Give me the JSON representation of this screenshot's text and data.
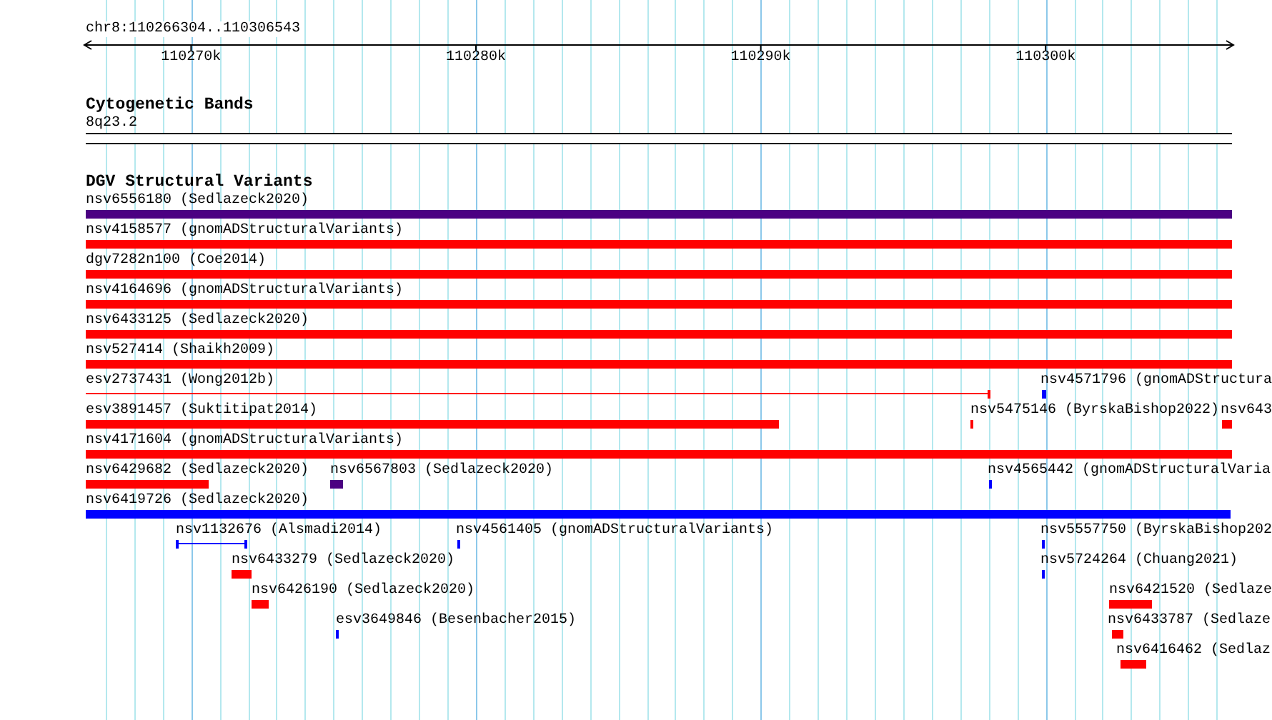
{
  "ruler": {
    "position": "chr8:110266304..110306543",
    "ticks": [
      "110270k",
      "110280k",
      "110290k",
      "110300k"
    ]
  },
  "cytogenetic_bands": {
    "title": "Cytogenetic Bands",
    "band": "8q23.2"
  },
  "structural_variants": {
    "title": "DGV Structural Variants",
    "features": [
      {
        "label": "nsv6556180 (Sedlazeck2020)",
        "color": "#4b0082",
        "kind": "block"
      },
      {
        "label": "nsv4158577 (gnomADStructuralVariants)",
        "color": "#ff0000",
        "kind": "block"
      },
      {
        "label": "dgv7282n100 (Coe2014)",
        "color": "#ff0000",
        "kind": "block"
      },
      {
        "label": "nsv4164696 (gnomADStructuralVariants)",
        "color": "#ff0000",
        "kind": "block"
      },
      {
        "label": "nsv6433125 (Sedlazeck2020)",
        "color": "#ff0000",
        "kind": "block"
      },
      {
        "label": "nsv527414 (Shaikh2009)",
        "color": "#ff0000",
        "kind": "block"
      },
      {
        "label": "esv2737431 (Wong2012b)",
        "color": "#ff0000",
        "kind": "span"
      },
      {
        "label": "nsv4571796 (gnomADStructura",
        "color": "#0000ff",
        "kind": "block"
      },
      {
        "label": "esv3891457 (Suktitipat2014)",
        "color": "#ff0000",
        "kind": "block"
      },
      {
        "label": "nsv5475146 (ByrskaBishop2022)",
        "color": "#ff0000",
        "kind": "block"
      },
      {
        "label": "nsv643",
        "color": "#ff0000",
        "kind": "block"
      },
      {
        "label": "nsv4171604 (gnomADStructuralVariants)",
        "color": "#ff0000",
        "kind": "block"
      },
      {
        "label": "nsv6429682 (Sedlazeck2020)",
        "color": "#ff0000",
        "kind": "block"
      },
      {
        "label": "nsv6567803 (Sedlazeck2020)",
        "color": "#4b0082",
        "kind": "block"
      },
      {
        "label": "nsv4565442 (gnomADStructuralVaria",
        "color": "#0000ff",
        "kind": "block"
      },
      {
        "label": "nsv6419726 (Sedlazeck2020)",
        "color": "#0000ff",
        "kind": "block"
      },
      {
        "label": "nsv1132676 (Alsmadi2014)",
        "color": "#0000ff",
        "kind": "span"
      },
      {
        "label": "nsv4561405 (gnomADStructuralVariants)",
        "color": "#0000ff",
        "kind": "block"
      },
      {
        "label": "nsv5557750 (ByrskaBishop202",
        "color": "#0000ff",
        "kind": "block"
      },
      {
        "label": "nsv6433279 (Sedlazeck2020)",
        "color": "#ff0000",
        "kind": "block"
      },
      {
        "label": "nsv5724264 (Chuang2021)",
        "color": "#0000ff",
        "kind": "block"
      },
      {
        "label": "nsv6426190 (Sedlazeck2020)",
        "color": "#ff0000",
        "kind": "block"
      },
      {
        "label": "nsv6421520 (Sedlaze",
        "color": "#ff0000",
        "kind": "block"
      },
      {
        "label": "esv3649846 (Besenbacher2015)",
        "color": "#0000ff",
        "kind": "block"
      },
      {
        "label": "nsv6433787 (Sedlaze",
        "color": "#ff0000",
        "kind": "block"
      },
      {
        "label": "nsv6416462 (Sedlaz",
        "color": "#ff0000",
        "kind": "block"
      }
    ]
  }
}
